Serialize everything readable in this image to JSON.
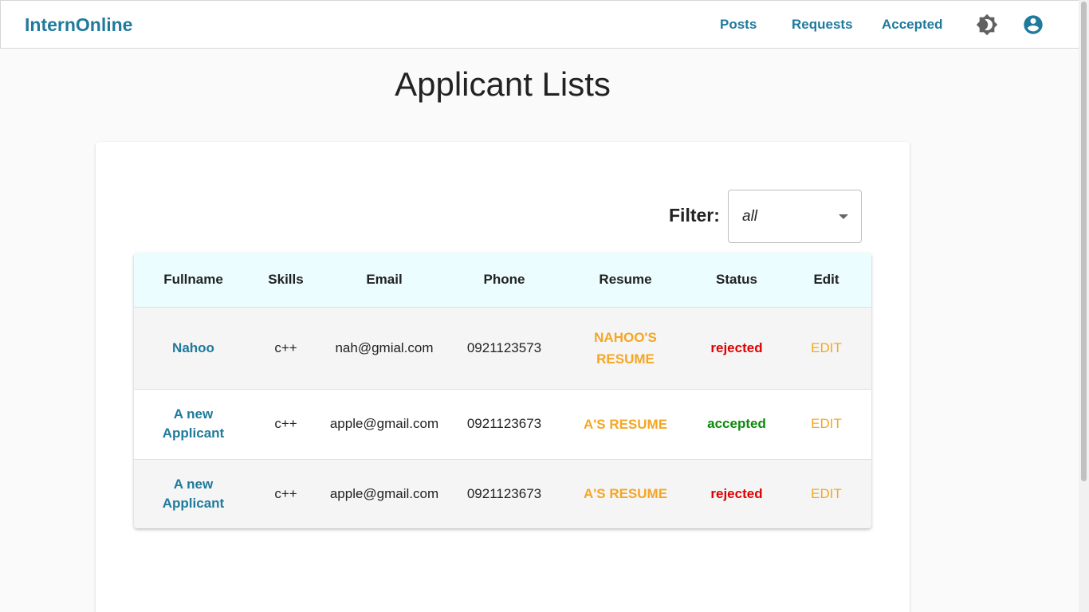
{
  "navbar": {
    "brand": "InternOnline",
    "links": [
      "Posts",
      "Requests",
      "Accepted"
    ],
    "icons": [
      "theme-toggle-icon",
      "account-circle-icon"
    ]
  },
  "page": {
    "title": "Applicant Lists"
  },
  "filter": {
    "label": "Filter:",
    "value": "all"
  },
  "table": {
    "columns": [
      "Fullname",
      "Skills",
      "Email",
      "Phone",
      "Resume",
      "Status",
      "Edit"
    ],
    "rows": [
      {
        "fullname": "Nahoo",
        "skills": "c++",
        "email": "nah@gmial.com",
        "phone": "0921123573",
        "resume": "NAHOO'S RESUME",
        "status": "rejected",
        "edit": "EDIT"
      },
      {
        "fullname": "A new Applicant",
        "skills": "c++",
        "email": "apple@gmail.com",
        "phone": "0921123673",
        "resume": "A'S RESUME",
        "status": "accepted",
        "edit": "EDIT"
      },
      {
        "fullname": "A new Applicant",
        "skills": "c++",
        "email": "apple@gmail.com",
        "phone": "0921123673",
        "resume": "A'S RESUME",
        "status": "rejected",
        "edit": "EDIT"
      }
    ]
  },
  "colors": {
    "brand": "#1f7a9c",
    "accent": "#f5a623",
    "rejected": "#e00000",
    "accepted": "#0a8a0a",
    "header_bg": "#ebfdfe"
  }
}
